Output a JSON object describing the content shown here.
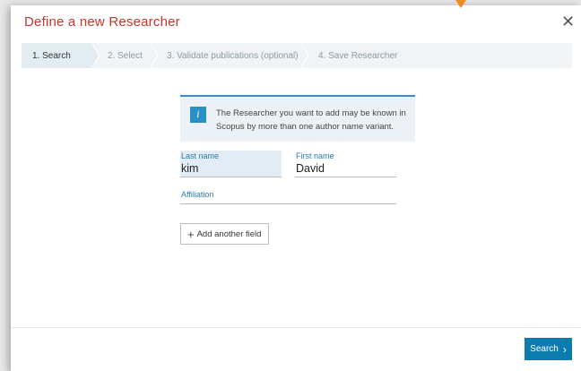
{
  "dialog": {
    "title": "Define a new Researcher",
    "close_glyph": "✕"
  },
  "steps": [
    {
      "label": "1. Search",
      "active": true
    },
    {
      "label": "2. Select",
      "active": false
    },
    {
      "label": "3. Validate publications (optional)",
      "active": false
    },
    {
      "label": "4. Save Researcher",
      "active": false
    }
  ],
  "info": {
    "icon": "i",
    "text": "The Researcher you want to add may be known in Scopus by more than one author name variant."
  },
  "form": {
    "last_name": {
      "label": "Last name",
      "value": "kim"
    },
    "first_name": {
      "label": "First name",
      "value": "David"
    },
    "affiliation": {
      "label": "Affiliation",
      "value": ""
    },
    "add_field": {
      "icon": "+",
      "label": "Add another field"
    }
  },
  "footer": {
    "search_label": "Search",
    "search_icon": "›"
  },
  "colors": {
    "title": "#c0392b",
    "accent": "#0c7cae",
    "pointer": "#f08a24"
  }
}
